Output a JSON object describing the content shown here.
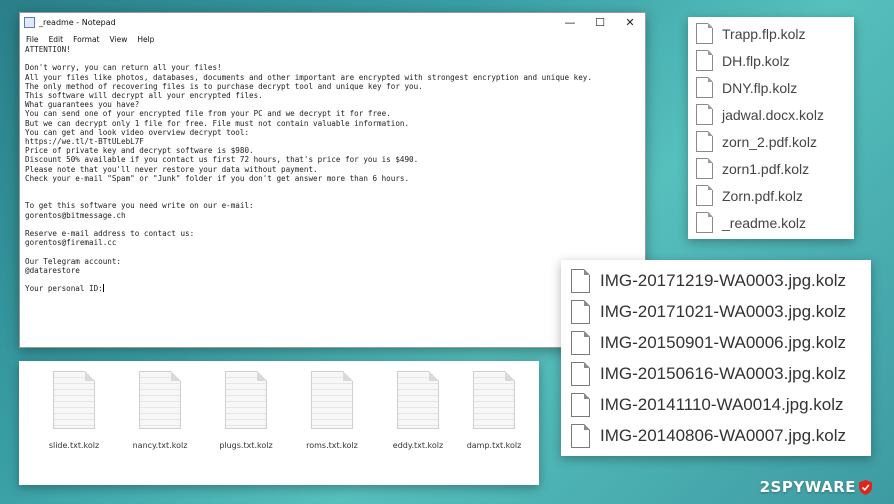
{
  "notepad": {
    "title": "_readme - Notepad",
    "controls": [
      "—",
      "☐",
      "✕"
    ],
    "menu": [
      "File",
      "Edit",
      "Format",
      "View",
      "Help"
    ],
    "body": "ATTENTION!\n\nDon't worry, you can return all your files!\nAll your files like photos, databases, documents and other important are encrypted with strongest encryption and unique key.\nThe only method of recovering files is to purchase decrypt tool and unique key for you.\nThis software will decrypt all your encrypted files.\nWhat guarantees you have?\nYou can send one of your encrypted file from your PC and we decrypt it for free.\nBut we can decrypt only 1 file for free. File must not contain valuable information.\nYou can get and look video overview decrypt tool:\nhttps://we.tl/t-BTtULebL7F\nPrice of private key and decrypt software is $980.\nDiscount 50% available if you contact us first 72 hours, that's price for you is $490.\nPlease note that you'll never restore your data without payment.\nCheck your e-mail \"Spam\" or \"Junk\" folder if you don't get answer more than 6 hours.\n\n\nTo get this software you need write on our e-mail:\ngorentos@bitmessage.ch\n\nReserve e-mail address to contact us:\ngorentos@firemail.cc\n\nOur Telegram account:\n@datarestore\n\nYour personal ID:"
  },
  "icon_files": [
    "slide.txt.kolz",
    "nancy.txt.kolz",
    "plugs.txt.kolz",
    "roms.txt.kolz",
    "eddy.txt.kolz",
    "damp.txt.kolz"
  ],
  "file_list_1": [
    "Trapp.flp.kolz",
    "DH.flp.kolz",
    "DNY.flp.kolz",
    "jadwal.docx.kolz",
    "zorn_2.pdf.kolz",
    "zorn1.pdf.kolz",
    "Zorn.pdf.kolz",
    "_readme.kolz"
  ],
  "file_list_2": [
    "IMG-20171219-WA0003.jpg.kolz",
    "IMG-20171021-WA0003.jpg.kolz",
    "IMG-20150901-WA0006.jpg.kolz",
    "IMG-20150616-WA0003.jpg.kolz",
    "IMG-20141110-WA0014.jpg.kolz",
    "IMG-20140806-WA0007.jpg.kolz"
  ],
  "watermark": {
    "text": "2SPYWARE",
    "accent_color": "#e2231a"
  },
  "icons": {
    "file": "document-icon",
    "app": "notepad-icon"
  }
}
